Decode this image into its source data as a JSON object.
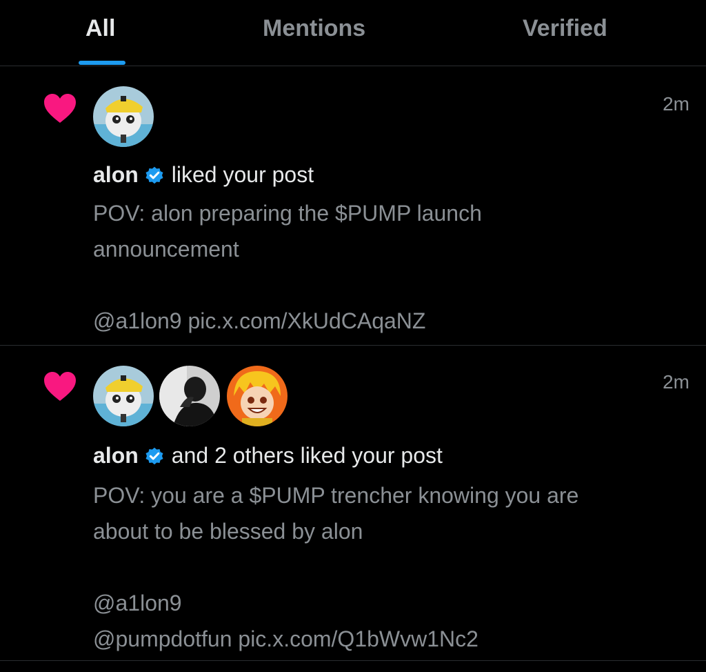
{
  "tabs": [
    {
      "label": "All",
      "active": true
    },
    {
      "label": "Mentions",
      "active": false
    },
    {
      "label": "Verified",
      "active": false
    }
  ],
  "colors": {
    "background": "#000000",
    "accent": "#1d9bf0",
    "heart": "#f91880",
    "primary_text": "#e7e9ea",
    "secondary_text": "#8b9095",
    "divider": "#2a2d30"
  },
  "notifications": [
    {
      "icon": "heart-icon",
      "time": "2m",
      "actor_name": "alon",
      "action": "liked your post",
      "post_lines": [
        "POV: alon preparing the $PUMP launch",
        "announcement",
        "",
        "@a1lon9 pic.x.com/XkUdCAqaNZ"
      ]
    },
    {
      "icon": "heart-icon",
      "time": "2m",
      "actor_name": "alon",
      "action": "and 2 others liked your post",
      "post_lines": [
        "POV:  you are a $PUMP trencher knowing you are",
        "about to be blessed by alon",
        "",
        "@a1lon9",
        "@pumpdotfun pic.x.com/Q1bWvw1Nc2"
      ]
    }
  ]
}
